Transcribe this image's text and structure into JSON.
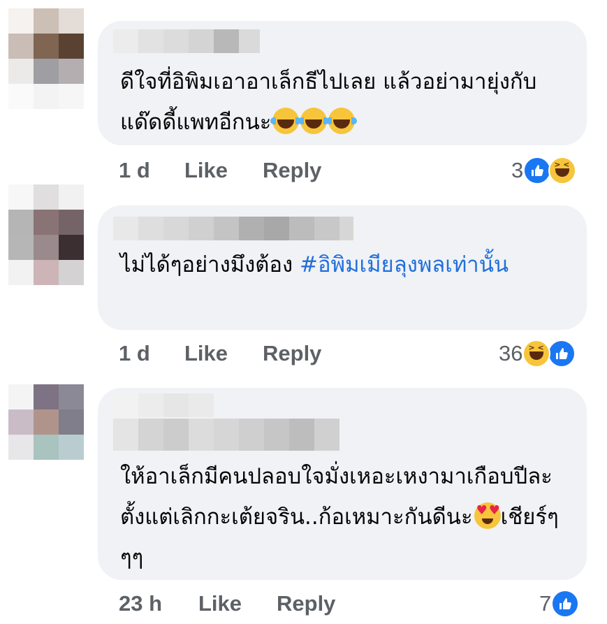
{
  "comments": [
    {
      "text": "ดีใจที่อิพิมเอาอาเล็กธีไปเลย แล้วอย่ามายุ่งกับแด๊ดดี้แพทอีกนะ",
      "emoji": [
        "laugh-cry-emoji",
        "laugh-cry-emoji",
        "laugh-cry-emoji"
      ],
      "time": "1 d",
      "like_label": "Like",
      "reply_label": "Reply",
      "reaction_count": "3",
      "reaction_icons": [
        "like-icon",
        "haha-icon"
      ]
    },
    {
      "text": "ไม่ได้ๆอย่างมึงต้อง ",
      "hashtag": "#อิพิมเมียลุงพลเท่านั้น",
      "time": "1 d",
      "like_label": "Like",
      "reply_label": "Reply",
      "reaction_count": "36",
      "reaction_icons": [
        "haha-icon",
        "like-icon"
      ]
    },
    {
      "text": "ให้อาเล็กมีคนปลอบใจมั่งเหอะเหงามาเกือบปีละตั้งแต่เลิกกะเต้ยจริน..ก้อเหมาะกันดีนะ",
      "emoji": [
        "heart-eyes-emoji"
      ],
      "text_after": "เชียร์ๆๆๆ",
      "time": "23 h",
      "like_label": "Like",
      "reply_label": "Reply",
      "reaction_count": "7",
      "reaction_icons": [
        "like-icon"
      ]
    }
  ],
  "colors": {
    "bubble": "#f0f2f5",
    "text": "#050505",
    "meta": "#5d6166",
    "hashtag": "#216fdb",
    "like": "#1a77f2"
  }
}
